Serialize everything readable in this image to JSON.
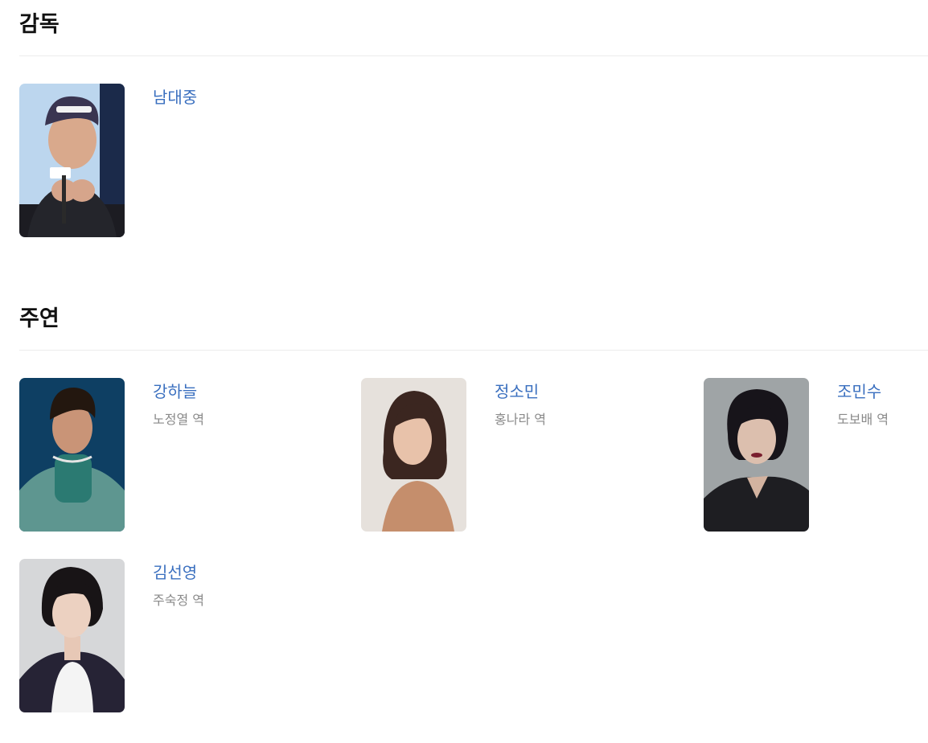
{
  "sections": {
    "director": {
      "title": "감독",
      "people": [
        {
          "name": "남대중"
        }
      ]
    },
    "cast": {
      "title": "주연",
      "people": [
        {
          "name": "강하늘",
          "role": "노정열 역"
        },
        {
          "name": "정소민",
          "role": "홍나라 역"
        },
        {
          "name": "조민수",
          "role": "도보배 역"
        },
        {
          "name": "김선영",
          "role": "주숙정 역"
        }
      ]
    }
  }
}
